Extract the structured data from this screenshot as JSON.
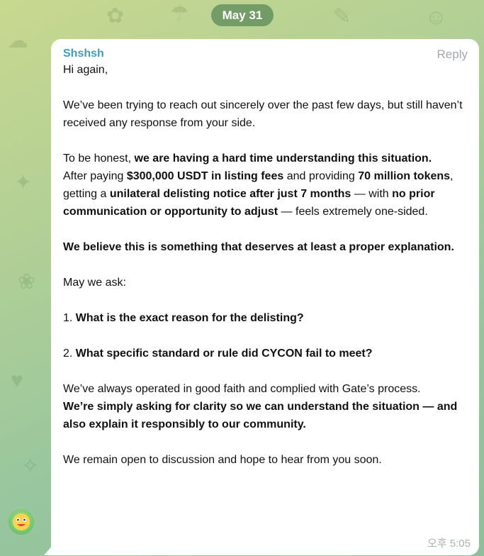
{
  "chat": {
    "date_separator": "May 31",
    "message": {
      "sender": "Shshsh",
      "reply_label": "Reply",
      "time": "오후 5:05",
      "paragraphs": [
        [
          {
            "t": "Hi again,",
            "b": false
          }
        ],
        [
          {
            "t": "We’ve been trying to reach out sincerely over the past few days, but still haven’t received any response from your side.",
            "b": false
          }
        ],
        [
          {
            "t": "To be honest, ",
            "b": false
          },
          {
            "t": "we are having a hard time understanding this situation.",
            "b": true
          },
          {
            "br": true
          },
          {
            "t": "After paying ",
            "b": false
          },
          {
            "t": "$300,000 USDT in listing fees",
            "b": true
          },
          {
            "t": " and providing ",
            "b": false
          },
          {
            "t": "70 million tokens",
            "b": true
          },
          {
            "t": ", getting a ",
            "b": false
          },
          {
            "t": "unilateral delisting notice after just 7 months",
            "b": true
          },
          {
            "t": " — with ",
            "b": false
          },
          {
            "t": "no prior communication or opportunity to adjust",
            "b": true
          },
          {
            "t": " — feels extremely one-sided.",
            "b": false
          }
        ],
        [
          {
            "t": "We believe this is something that deserves at least a proper explanation.",
            "b": true
          }
        ],
        [
          {
            "t": "May we ask:",
            "b": false
          }
        ],
        [
          {
            "t": "1. ",
            "b": false
          },
          {
            "t": "What is the exact reason for the delisting?",
            "b": true
          }
        ],
        [
          {
            "t": "2. ",
            "b": false
          },
          {
            "t": "What specific standard or rule did CYCON fail to meet?",
            "b": true
          }
        ],
        [
          {
            "t": "We’ve always operated in good faith and complied with Gate’s process.",
            "b": false
          },
          {
            "br": true
          },
          {
            "t": "We’re simply asking for clarity so we can understand the situation — and also explain it responsibly to our community.",
            "b": true
          }
        ],
        [
          {
            "t": "We remain open to discussion and hope to hear from you soon.",
            "b": false
          }
        ]
      ]
    }
  }
}
